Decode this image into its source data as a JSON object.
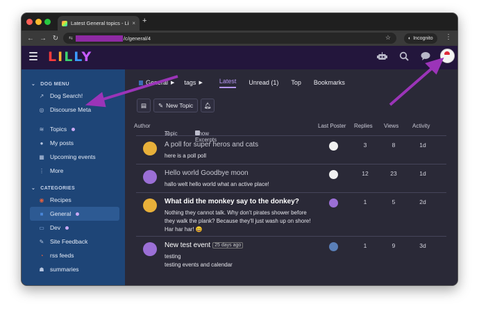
{
  "browser": {
    "tab_title": "Latest General topics - LillyP",
    "tab_close": "×",
    "new_tab": "+",
    "url_redacted_prefix": "",
    "url_path": "/c/general/4",
    "incognito_label": "Incognito",
    "back": "←",
    "forward": "→",
    "reload": "↻",
    "star": "☆",
    "menu": "⋮",
    "traffic_lights": [
      "#ff5f57",
      "#febc2e",
      "#28c840"
    ]
  },
  "header": {
    "logo_letters": [
      "L",
      "I",
      "L",
      "L",
      "Y"
    ],
    "logo_colors": [
      "#ff3b3b",
      "#ffb02e",
      "#3bd16f",
      "#3b9bff",
      "#c65bff"
    ],
    "icons": [
      "robot-icon",
      "search-icon",
      "chat-icon",
      "user-avatar"
    ]
  },
  "sidebar": {
    "dog_menu_heading": "DOG MENU",
    "dog_items": [
      {
        "label": "Dog Search!",
        "icon": "link-icon",
        "glyph": "↗"
      },
      {
        "label": "Discourse Meta",
        "icon": "discourse-icon",
        "glyph": "◎"
      }
    ],
    "main_items": [
      {
        "label": "Topics",
        "icon": "layers-icon",
        "glyph": "≋",
        "dot": true
      },
      {
        "label": "My posts",
        "icon": "user-icon",
        "glyph": "●"
      },
      {
        "label": "Upcoming events",
        "icon": "calendar-icon",
        "glyph": "▦"
      },
      {
        "label": "More",
        "icon": "more-icon",
        "glyph": "⋮"
      }
    ],
    "categories_heading": "CATEGORIES",
    "categories": [
      {
        "label": "Recipes",
        "icon": "recipes-icon",
        "glyph": "◉",
        "color": "#e0603f"
      },
      {
        "label": "General",
        "icon": "general-icon",
        "glyph": "■",
        "color": "#4a86d8",
        "dot": true,
        "active": true
      },
      {
        "label": "Dev",
        "icon": "dev-icon",
        "glyph": "▭",
        "color": "#8fb4e8",
        "dot": true
      },
      {
        "label": "Site Feedback",
        "icon": "feedback-icon",
        "glyph": "✎",
        "color": "#c8d4ea"
      },
      {
        "label": "rss feeds",
        "icon": "rss-icon",
        "glyph": "◔",
        "color": "#e0603f"
      },
      {
        "label": "summaries",
        "icon": "summaries-icon",
        "glyph": "☗",
        "color": "#c8d4ea"
      }
    ]
  },
  "nav": {
    "category": "General",
    "tags": "tags",
    "tabs": [
      {
        "label": "Latest",
        "active": true
      },
      {
        "label": "Unread (1)"
      },
      {
        "label": "Top"
      },
      {
        "label": "Bookmarks"
      }
    ]
  },
  "toolbar": {
    "new_topic": "New Topic"
  },
  "table": {
    "headers": {
      "author": "Author",
      "topic": "Topic",
      "show_excerpts": "Show Excerpts",
      "last_poster": "Last Poster",
      "replies": "Replies",
      "views": "Views",
      "activity": "Activity"
    },
    "rows": [
      {
        "title": "A poll for super heros and cats",
        "excerpt": "here is a poll poll",
        "replies": "3",
        "views": "8",
        "activity": "1d",
        "unread": false,
        "author_color": "#e8b03a",
        "poster_color": "#f0f0f0",
        "badge": ""
      },
      {
        "title": "Hello world Goodbye moon",
        "excerpt": "hallo welt hello world what an active place!",
        "replies": "12",
        "views": "23",
        "activity": "1d",
        "unread": false,
        "author_color": "#9b6fd6",
        "poster_color": "#f0f0f0",
        "badge": ""
      },
      {
        "title": "What did the monkey say to the donkey?",
        "excerpt": "Nothing they cannot talk. Why don't pirates shower before they walk the plank? Because they'll just wash up on shore! Har har har! 😄",
        "replies": "1",
        "views": "5",
        "activity": "2d",
        "unread": true,
        "author_color": "#e8b03a",
        "poster_color": "#9b6fd6",
        "badge": ""
      },
      {
        "title": "New test event",
        "excerpt": "testing\ntesting events and calendar",
        "replies": "1",
        "views": "9",
        "activity": "3d",
        "unread": true,
        "author_color": "#9b6fd6",
        "poster_color": "#5a7fb8",
        "badge": "25 days ago"
      }
    ]
  }
}
